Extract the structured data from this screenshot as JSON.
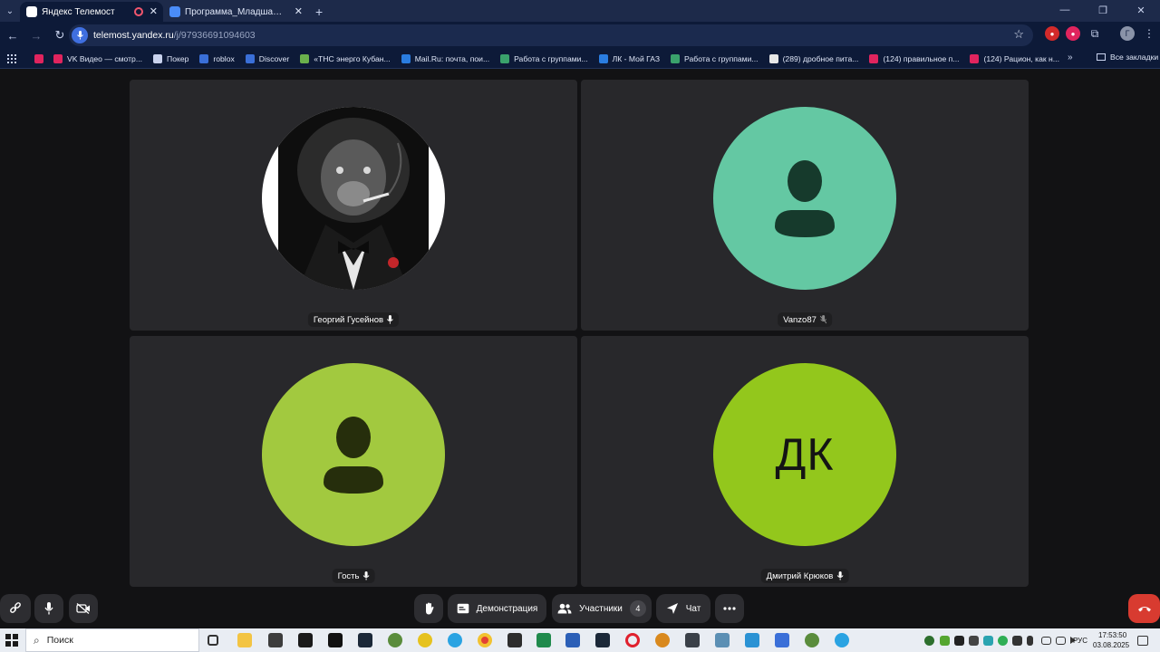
{
  "browser": {
    "tabs": [
      {
        "title": "Яндекс Телемост",
        "active": true
      },
      {
        "title": "Программа_Младшая_До_Ре...",
        "active": false
      }
    ],
    "url_host": "telemost.yandex.ru",
    "url_path": "/j/97936691094603",
    "bookmarks": [
      {
        "label": "VK Видео — смотр...",
        "color": "#e0245e"
      },
      {
        "label": "Покер",
        "color": "#c9d3ee"
      },
      {
        "label": "roblox",
        "color": "#3a6fd8"
      },
      {
        "label": "Discover",
        "color": "#3a6fd8"
      },
      {
        "label": "«ТНС энерго Кубан...",
        "color": "#6ab04c"
      },
      {
        "label": "Mail.Ru: почта, пои...",
        "color": "#2a7de1"
      },
      {
        "label": "Работа с группами...",
        "color": "#3aa26c"
      },
      {
        "label": "ЛК - Мой ГАЗ",
        "color": "#2a7de1"
      },
      {
        "label": "Работа с группами...",
        "color": "#3aa26c"
      },
      {
        "label": "(289) дробное пита...",
        "color": "#e7e7e7"
      },
      {
        "label": "(124) правильное п...",
        "color": "#e0245e"
      },
      {
        "label": "(124) Рацион, как н...",
        "color": "#e0245e"
      }
    ],
    "bookmarks_more": "»",
    "all_bookmarks": "Все закладки",
    "profile_initial": "Г"
  },
  "participants": [
    {
      "name": "Георгий Гусейнов",
      "avatar": "photo",
      "muted": false
    },
    {
      "name": "Vanzo87",
      "avatar": "placeholder",
      "color": "#64c8a3",
      "muted": true
    },
    {
      "name": "Гость",
      "avatar": "placeholder",
      "color": "#a2c93f",
      "muted": false
    },
    {
      "name": "Дмитрий Крюков",
      "avatar": "initials",
      "initials": "ДК",
      "color": "#93c71c",
      "muted": false
    }
  ],
  "toolbar": {
    "demo_label": "Демонстрация",
    "participants_label": "Участники",
    "participants_count": "4",
    "chat_label": "Чат"
  },
  "taskbar": {
    "search_placeholder": "Поиск",
    "lang": "РУС",
    "time": "17:53:50",
    "date": "03.08.2025"
  }
}
